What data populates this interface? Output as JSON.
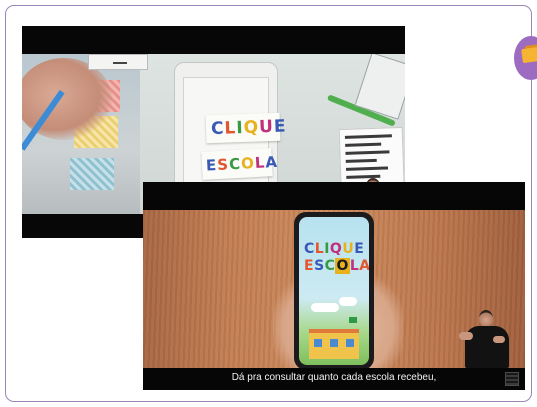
{
  "video1": {
    "logo_line1": [
      "C",
      "L",
      "I",
      "Q",
      "U",
      "E"
    ],
    "logo_line2": [
      "E",
      "S",
      "C",
      "O",
      "L",
      "A"
    ]
  },
  "video2": {
    "app_logo_line1": [
      "C",
      "L",
      "I",
      "Q",
      "U",
      "E"
    ],
    "app_logo_line2": [
      "E",
      "S",
      "C",
      "O",
      "L",
      "A"
    ],
    "subtitle": "Dá pra consultar quanto cada escola recebeu,"
  },
  "icons": {
    "app_icon": "clique-escola-app-icon",
    "qr": "qr-code-icon"
  },
  "colors": {
    "frame_border": "#9c86b8",
    "app_icon_bg": "#9d6bc0",
    "app_icon_accent": "#f5b431"
  }
}
